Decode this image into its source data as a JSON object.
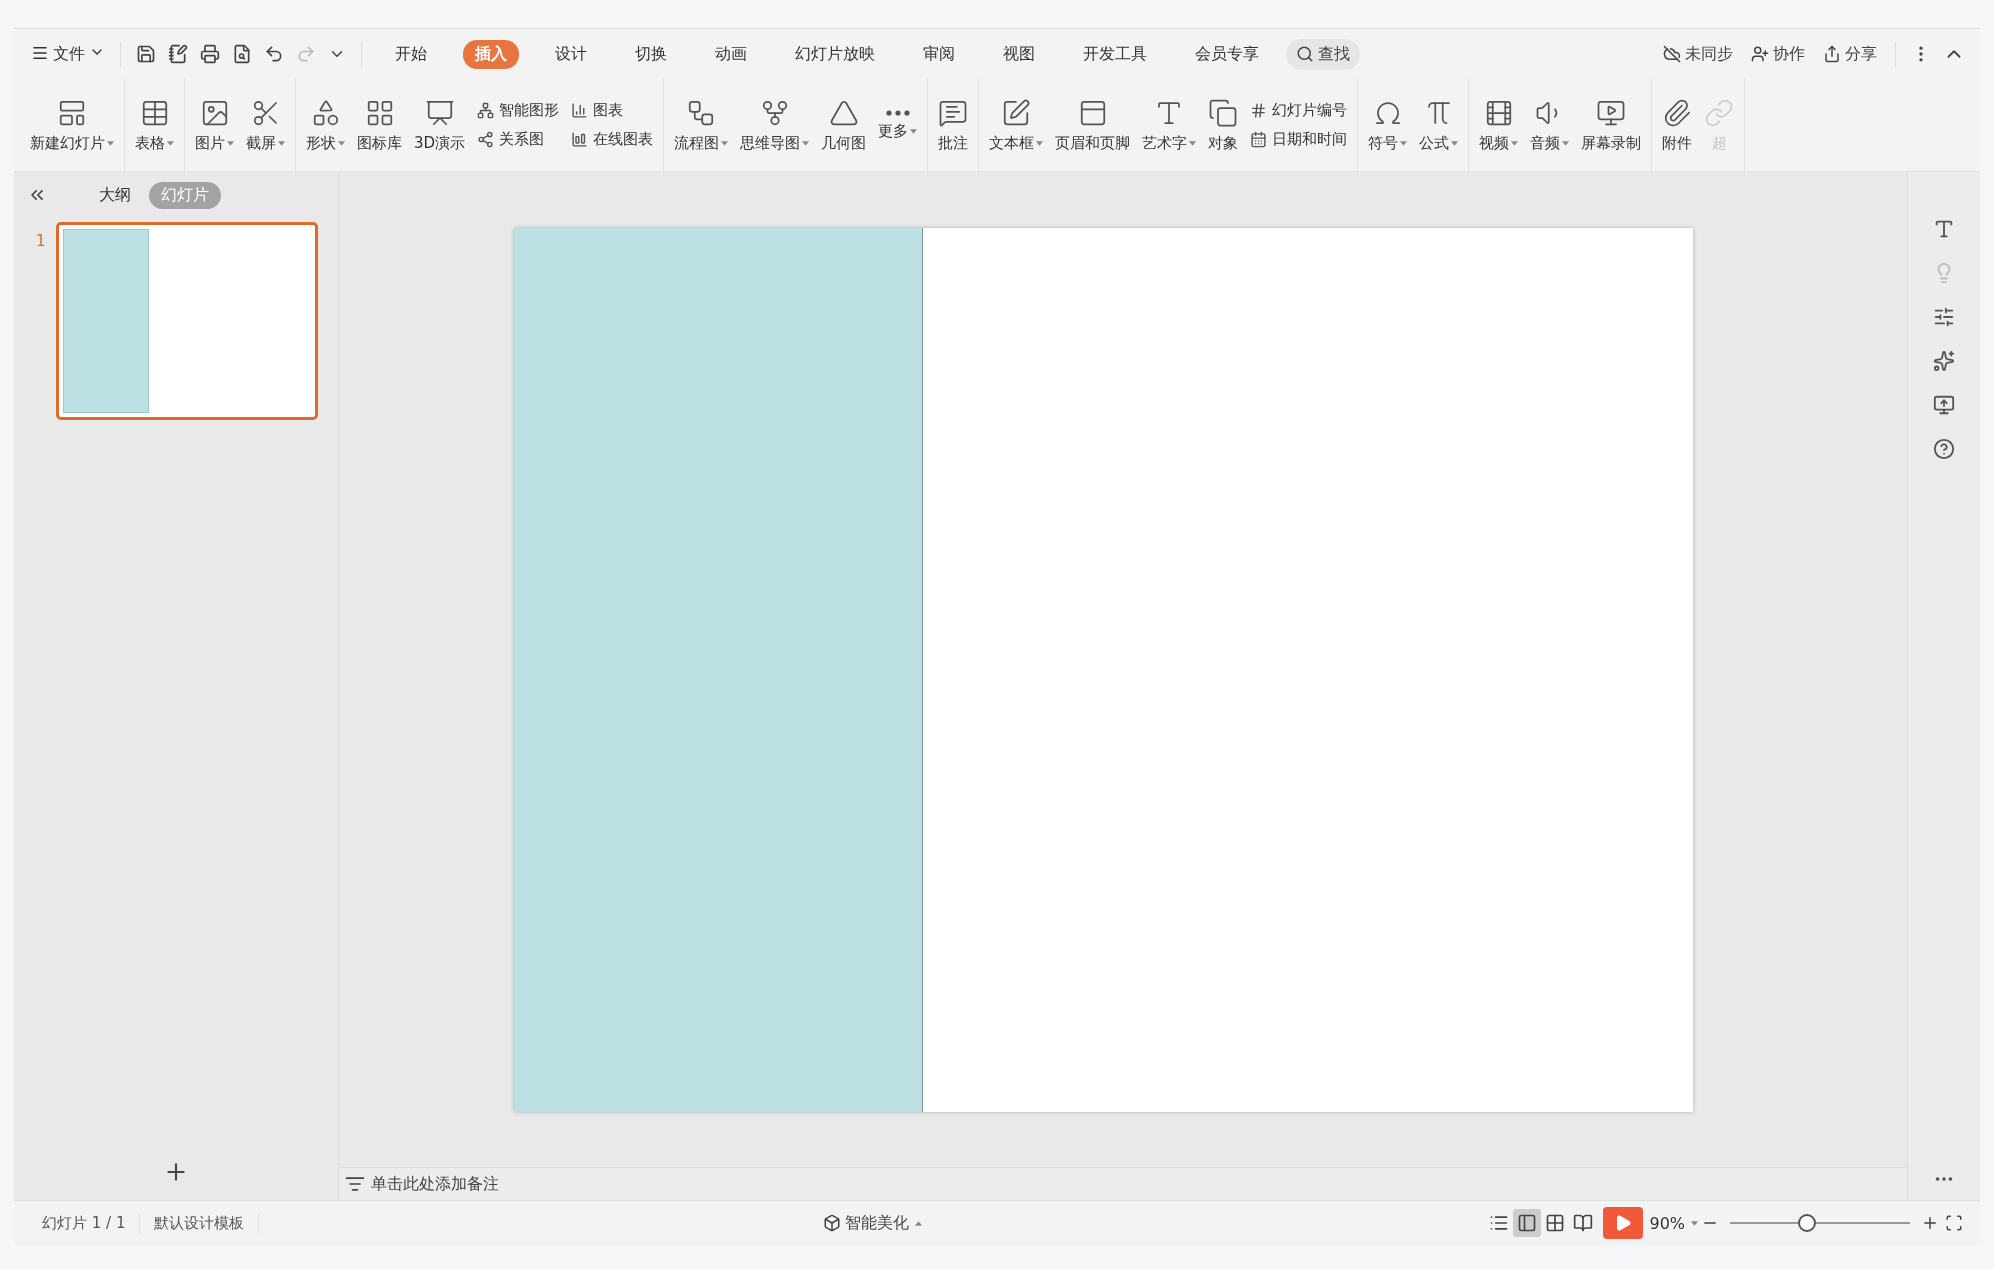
{
  "menu": {
    "file": "文件",
    "tabs": [
      {
        "label": "开始",
        "selected": false
      },
      {
        "label": "插入",
        "selected": true
      },
      {
        "label": "设计",
        "selected": false
      },
      {
        "label": "切换",
        "selected": false
      },
      {
        "label": "动画",
        "selected": false
      },
      {
        "label": "幻灯片放映",
        "selected": false
      },
      {
        "label": "审阅",
        "selected": false
      },
      {
        "label": "视图",
        "selected": false
      },
      {
        "label": "开发工具",
        "selected": false
      },
      {
        "label": "会员专享",
        "selected": false
      }
    ],
    "search": "查找",
    "actions": [
      "未同步",
      "协作",
      "分享"
    ]
  },
  "ribbon": [
    {
      "items": [
        {
          "kind": "large",
          "label": "新建幻灯片",
          "dropdown": true
        }
      ]
    },
    {
      "items": [
        {
          "kind": "large",
          "label": "表格",
          "dropdown": true
        }
      ]
    },
    {
      "items": [
        {
          "kind": "large",
          "label": "图片",
          "dropdown": true
        },
        {
          "kind": "large",
          "label": "截屏",
          "dropdown": true
        }
      ]
    },
    {
      "items": [
        {
          "kind": "large",
          "label": "形状",
          "dropdown": true
        },
        {
          "kind": "large",
          "label": "图标库",
          "dropdown": false
        },
        {
          "kind": "large",
          "label": "3D演示",
          "dropdown": false
        },
        {
          "kind": "stack",
          "labels": [
            "智能图形",
            "关系图"
          ]
        },
        {
          "kind": "stack",
          "labels": [
            "图表",
            "在线图表"
          ]
        }
      ]
    },
    {
      "items": [
        {
          "kind": "large",
          "label": "流程图",
          "dropdown": true
        },
        {
          "kind": "large",
          "label": "思维导图",
          "dropdown": true
        },
        {
          "kind": "large",
          "label": "几何图",
          "dropdown": false
        },
        {
          "kind": "large",
          "label": "更多",
          "dropdown": true
        }
      ]
    },
    {
      "items": [
        {
          "kind": "large",
          "label": "批注",
          "dropdown": false
        }
      ]
    },
    {
      "items": [
        {
          "kind": "large",
          "label": "文本框",
          "dropdown": true
        },
        {
          "kind": "large",
          "label": "页眉和页脚",
          "dropdown": false
        },
        {
          "kind": "large",
          "label": "艺术字",
          "dropdown": true
        },
        {
          "kind": "large",
          "label": "对象",
          "dropdown": false
        },
        {
          "kind": "stack",
          "labels": [
            "幻灯片编号",
            "日期和时间"
          ]
        }
      ]
    },
    {
      "items": [
        {
          "kind": "large",
          "label": "符号",
          "dropdown": true
        },
        {
          "kind": "large",
          "label": "公式",
          "dropdown": true
        }
      ]
    },
    {
      "items": [
        {
          "kind": "large",
          "label": "视频",
          "dropdown": true
        },
        {
          "kind": "large",
          "label": "音频",
          "dropdown": true
        },
        {
          "kind": "large",
          "label": "屏幕录制",
          "dropdown": false
        }
      ]
    },
    {
      "items": [
        {
          "kind": "large",
          "label": "附件",
          "dropdown": false
        },
        {
          "kind": "faded",
          "label": "超",
          "dropdown": false
        }
      ]
    }
  ],
  "panel": {
    "tabs": [
      {
        "label": "大纲",
        "selected": false
      },
      {
        "label": "幻灯片",
        "selected": true
      }
    ],
    "slides": [
      {
        "number": "1",
        "selected": true
      }
    ]
  },
  "notes_placeholder": "单击此处添加备注",
  "status_bar": {
    "slide_info": "幻灯片 1 / 1",
    "template": "默认设计模板",
    "beautify": "智能美化",
    "zoom": "90%",
    "zoom_slider": {
      "level": 0.43
    }
  }
}
